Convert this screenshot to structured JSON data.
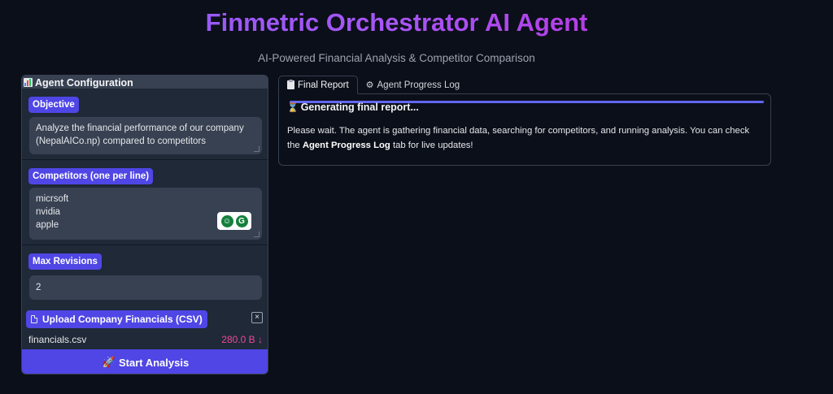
{
  "header": {
    "title": "Finmetric Orchestrator AI Agent",
    "subtitle": "AI-Powered Financial Analysis & Competitor Comparison"
  },
  "config": {
    "title": "Agent Configuration",
    "objective_label": "Objective",
    "objective_value": "Analyze the financial performance of our company (NepalAICo.np) compared to competitors",
    "competitors_label": "Competitors (one per line)",
    "competitors_value": "micrsoft\nnvidia\napple",
    "max_revisions_label": "Max Revisions",
    "max_revisions_value": "2",
    "upload_label": "Upload Company Financials (CSV)",
    "close_glyph": "×",
    "file_name": "financials.csv",
    "file_size": "280.0 B ↓",
    "start_button": "Start Analysis"
  },
  "tabs": [
    {
      "label": "Final Report",
      "active": true
    },
    {
      "label": "Agent Progress Log",
      "active": false
    }
  ],
  "report": {
    "heading": "Generating final report...",
    "text_part1": "Please wait. The agent is gathering financial data, searching for competitors, and running analysis. You can check the ",
    "text_bold": "Agent Progress Log",
    "text_part2": " tab for live updates!",
    "progress": 1.0
  },
  "colors": {
    "accent": "#4f46e5",
    "title_gradient_start": "#8b5cf6",
    "title_gradient_end": "#c026d3",
    "file_size": "#ec4899"
  },
  "icons": {
    "config": "bar-chart-icon",
    "upload": "file-icon",
    "start": "rocket-icon",
    "final_report_tab": "clipboard-icon",
    "progress_log_tab": "gear-icon",
    "report_heading": "hourglass-icon"
  }
}
